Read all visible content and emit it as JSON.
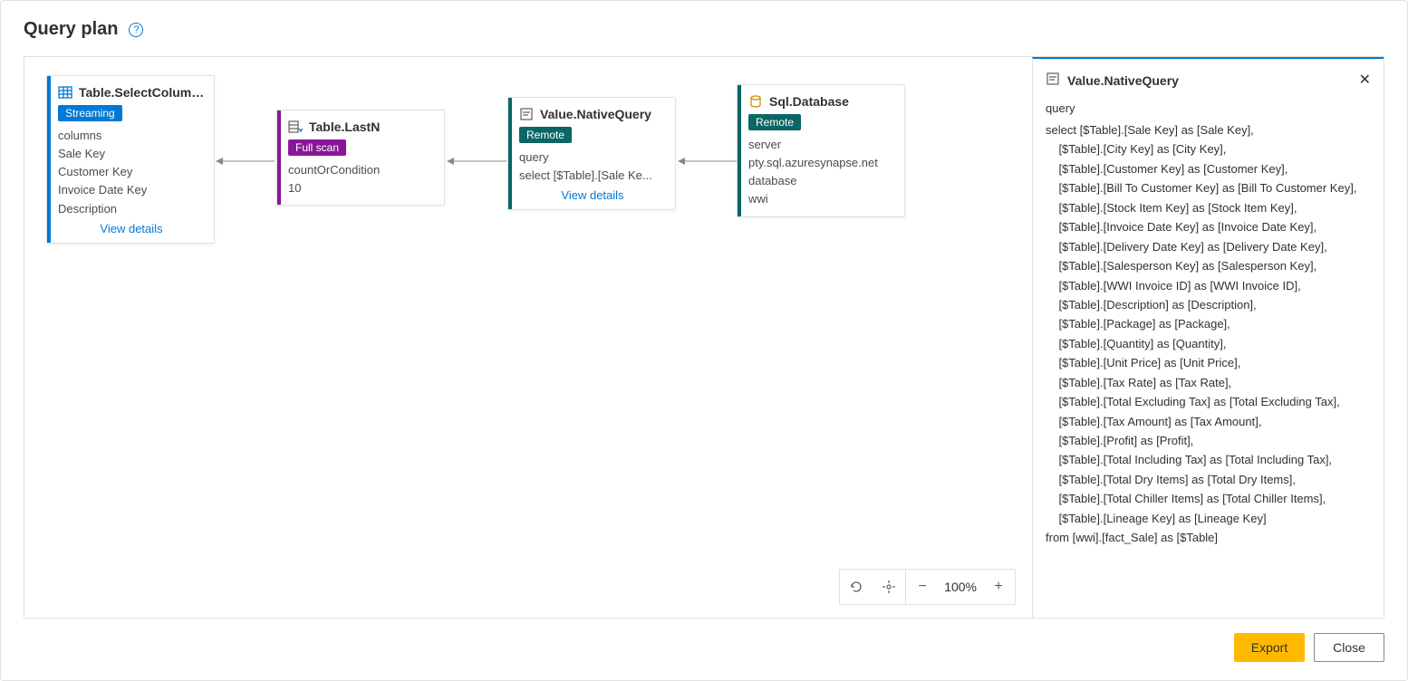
{
  "header": {
    "title": "Query plan"
  },
  "zoom": {
    "percent": "100%"
  },
  "buttons": {
    "export": "Export",
    "close": "Close"
  },
  "nodes": {
    "select": {
      "title": "Table.SelectColumns",
      "tag": "Streaming",
      "rows": [
        "columns",
        "Sale Key",
        "Customer Key",
        "Invoice Date Key",
        "Description"
      ],
      "view_details": "View details"
    },
    "lastn": {
      "title": "Table.LastN",
      "tag": "Full scan",
      "rows": [
        "countOrCondition",
        "10"
      ]
    },
    "native": {
      "title": "Value.NativeQuery",
      "tag": "Remote",
      "rows": [
        "query",
        "select [$Table].[Sale Ke..."
      ],
      "view_details": "View details"
    },
    "sqldb": {
      "title": "Sql.Database",
      "tag": "Remote",
      "rows": [
        "server",
        "pty.sql.azuresynapse.net",
        "database",
        "wwi"
      ]
    }
  },
  "details": {
    "title": "Value.NativeQuery",
    "label": "query",
    "body": "select [$Table].[Sale Key] as [Sale Key],\n    [$Table].[City Key] as [City Key],\n    [$Table].[Customer Key] as [Customer Key],\n    [$Table].[Bill To Customer Key] as [Bill To Customer Key],\n    [$Table].[Stock Item Key] as [Stock Item Key],\n    [$Table].[Invoice Date Key] as [Invoice Date Key],\n    [$Table].[Delivery Date Key] as [Delivery Date Key],\n    [$Table].[Salesperson Key] as [Salesperson Key],\n    [$Table].[WWI Invoice ID] as [WWI Invoice ID],\n    [$Table].[Description] as [Description],\n    [$Table].[Package] as [Package],\n    [$Table].[Quantity] as [Quantity],\n    [$Table].[Unit Price] as [Unit Price],\n    [$Table].[Tax Rate] as [Tax Rate],\n    [$Table].[Total Excluding Tax] as [Total Excluding Tax],\n    [$Table].[Tax Amount] as [Tax Amount],\n    [$Table].[Profit] as [Profit],\n    [$Table].[Total Including Tax] as [Total Including Tax],\n    [$Table].[Total Dry Items] as [Total Dry Items],\n    [$Table].[Total Chiller Items] as [Total Chiller Items],\n    [$Table].[Lineage Key] as [Lineage Key]\nfrom [wwi].[fact_Sale] as [$Table]"
  }
}
